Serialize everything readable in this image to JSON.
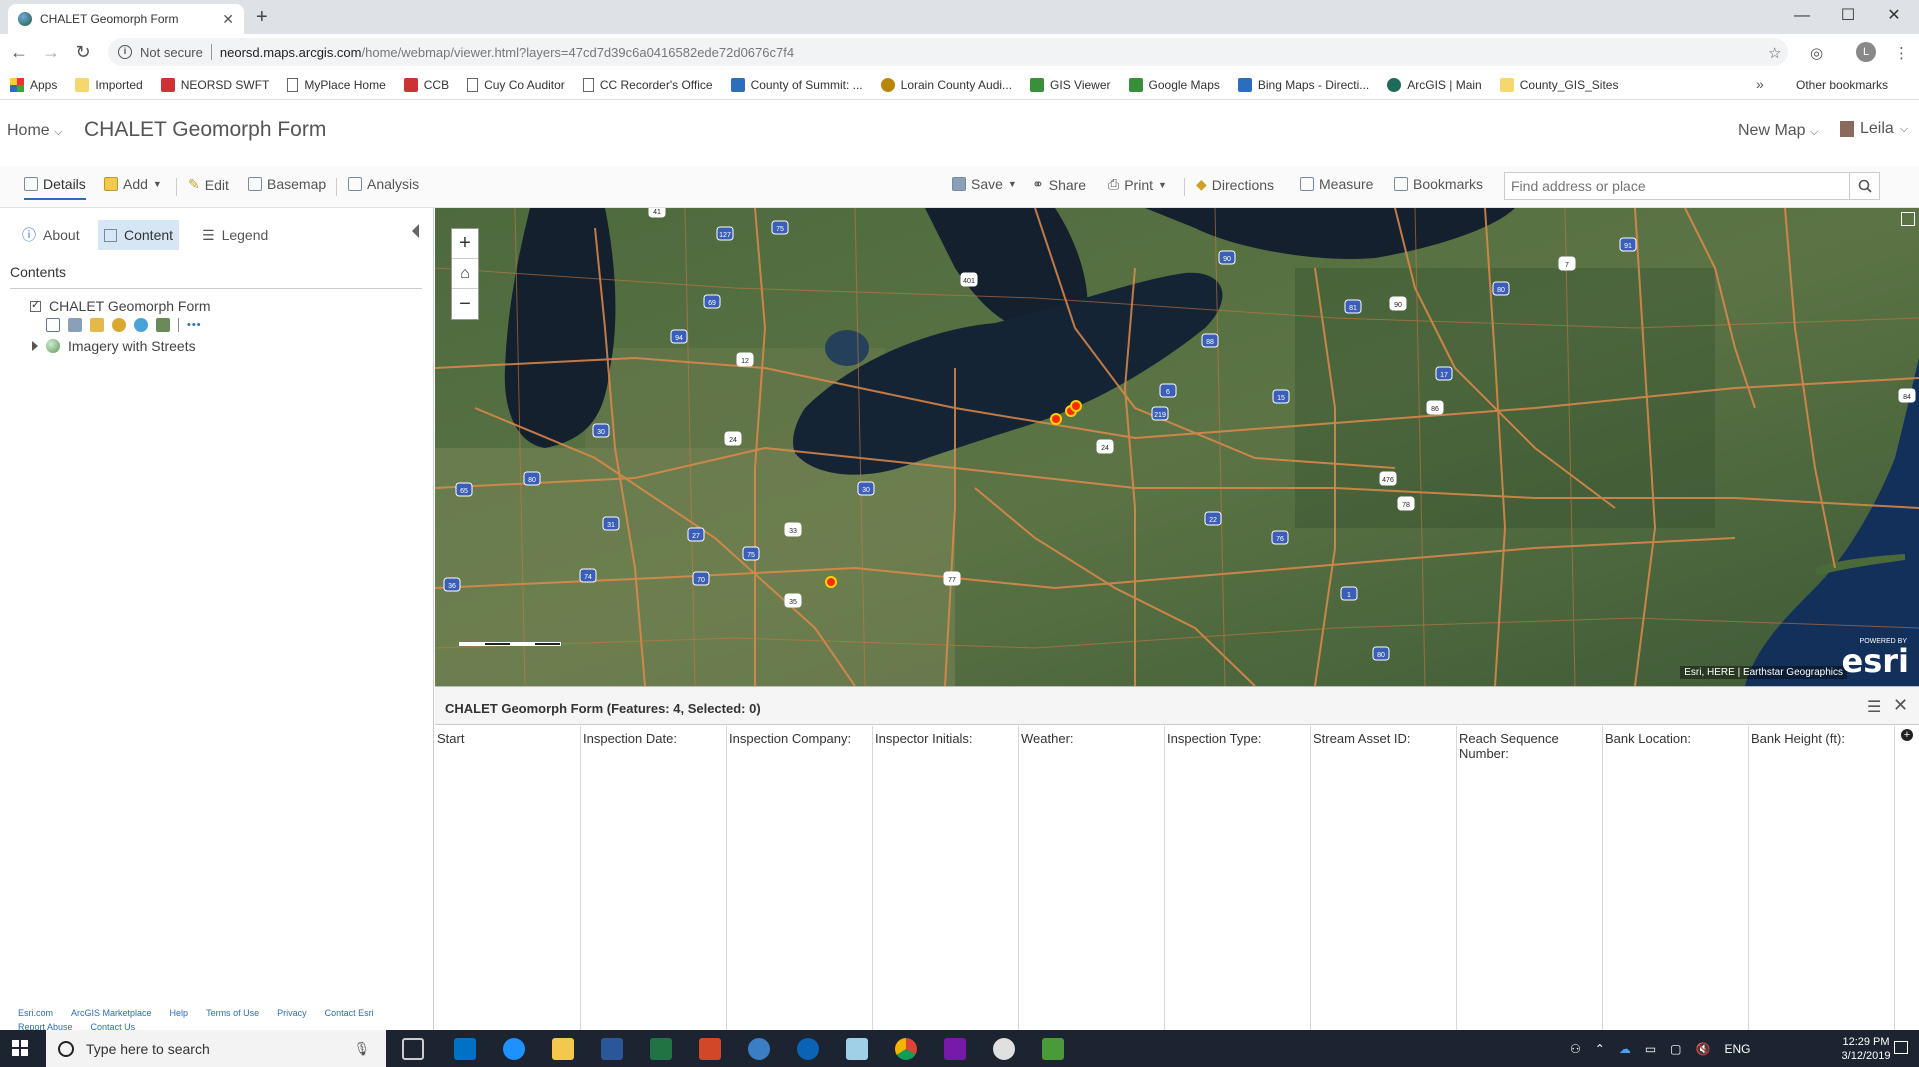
{
  "browser": {
    "tab_title": "CHALET Geomorph Form",
    "tab_close": "✕",
    "new_tab": "+",
    "not_secure": "Not secure",
    "url_domain": "neorsd.maps.arcgis.com",
    "url_path": "/home/webmap/viewer.html?layers=47cd7d39c6a0416582ede72d0676c7f4",
    "avatar_letter": "L",
    "bookmarks": [
      {
        "label": "Apps",
        "icon": "apps-grid-icon"
      },
      {
        "label": "Imported",
        "icon": "folder-icon"
      },
      {
        "label": "NEORSD SWFT",
        "icon": "neorsd-icon"
      },
      {
        "label": "MyPlace Home",
        "icon": "page-icon"
      },
      {
        "label": "CCB",
        "icon": "ccb-icon"
      },
      {
        "label": "Cuy Co Auditor",
        "icon": "page-icon"
      },
      {
        "label": "CC Recorder's Office",
        "icon": "page-icon"
      },
      {
        "label": "County of Summit: ...",
        "icon": "summit-icon"
      },
      {
        "label": "Lorain County Audi...",
        "icon": "lorain-icon"
      },
      {
        "label": "GIS Viewer",
        "icon": "gis-viewer-icon"
      },
      {
        "label": "Google Maps",
        "icon": "google-maps-icon"
      },
      {
        "label": "Bing Maps - Directi...",
        "icon": "bing-icon"
      },
      {
        "label": "ArcGIS | Main",
        "icon": "arcgis-icon"
      },
      {
        "label": "County_GIS_Sites",
        "icon": "folder-icon"
      }
    ],
    "bookmarks_more": "»",
    "other_bookmarks": "Other bookmarks"
  },
  "app": {
    "home": "Home",
    "title": "CHALET Geomorph Form",
    "new_map": "New Map",
    "user": "Leila"
  },
  "toolbar": {
    "details": "Details",
    "add": "Add",
    "edit": "Edit",
    "basemap": "Basemap",
    "analysis": "Analysis",
    "save": "Save",
    "share": "Share",
    "print": "Print",
    "directions": "Directions",
    "measure": "Measure",
    "bookmarks": "Bookmarks",
    "search_placeholder": "Find address or place"
  },
  "panel": {
    "tabs": {
      "about": "About",
      "content": "Content",
      "legend": "Legend"
    },
    "contents_header": "Contents",
    "layers": [
      {
        "name": "CHALET Geomorph Form",
        "checked": true
      },
      {
        "name": "Imagery with Streets"
      }
    ],
    "more": "•••",
    "footer_links": [
      "Esri.com",
      "ArcGIS Marketplace",
      "Help",
      "Terms of Use",
      "Privacy",
      "Contact Esri",
      "Report Abuse",
      "Contact Us"
    ]
  },
  "map": {
    "zoom_in": "+",
    "zoom_out": "−",
    "attribution": "Esri, HERE | Earthstar Geographics",
    "powered_by": "POWERED BY",
    "logo": "esri",
    "highway_labels": [
      "41",
      "75",
      "127",
      "401",
      "90",
      "91",
      "7",
      "69",
      "94",
      "12",
      "88",
      "81",
      "90",
      "80",
      "6",
      "86",
      "17",
      "15",
      "84",
      "219",
      "30",
      "24",
      "80",
      "65",
      "24",
      "30",
      "80",
      "476",
      "31",
      "27",
      "33",
      "22",
      "75",
      "78",
      "74",
      "70",
      "77",
      "76",
      "36",
      "35",
      "1"
    ],
    "feature_color": "#ff2a00"
  },
  "attribute_table": {
    "title": "CHALET Geomorph Form (Features: 4, Selected: 0)",
    "menu": "☰",
    "close": "✕",
    "columns": [
      "Start",
      "Inspection Date:",
      "Inspection Company:",
      "Inspector Initials:",
      "Weather:",
      "Inspection Type:",
      "Stream Asset ID:",
      "Reach Sequence Number:",
      "Bank Location:",
      "Bank Height (ft):"
    ],
    "add": "+"
  },
  "taskbar": {
    "search_placeholder": "Type here to search",
    "time": "12:29 PM",
    "date": "3/12/2019",
    "language": "ENG"
  }
}
